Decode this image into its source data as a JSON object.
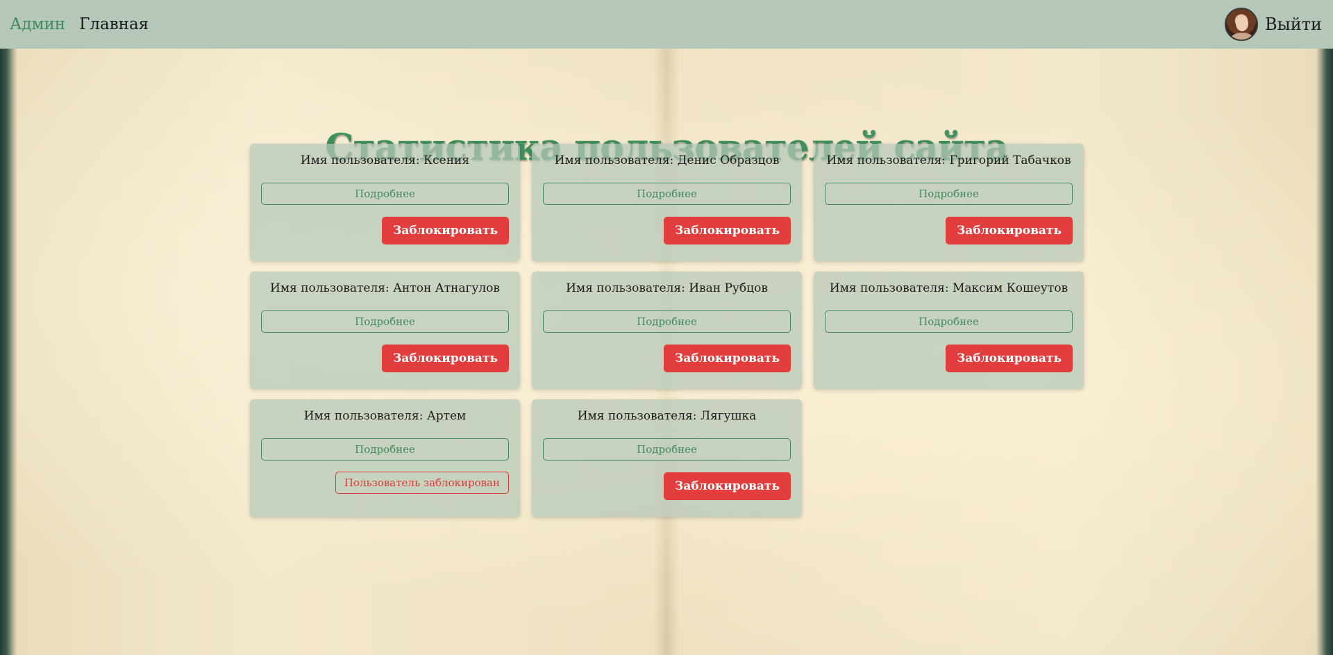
{
  "nav": {
    "admin_label": "Админ",
    "home_label": "Главная",
    "logout_label": "Выйти"
  },
  "page": {
    "title": "Статистика пользователей сайта"
  },
  "users": [
    {
      "title": "Имя пользователя: Ксения",
      "details_label": "Подробнее",
      "action_label": "Заблокировать",
      "blocked": false
    },
    {
      "title": "Имя пользователя: Денис Образцов",
      "details_label": "Подробнее",
      "action_label": "Заблокировать",
      "blocked": false
    },
    {
      "title": "Имя пользователя: Григорий Табачков",
      "details_label": "Подробнее",
      "action_label": "Заблокировать",
      "blocked": false
    },
    {
      "title": "Имя пользователя: Антон Атнагулов",
      "details_label": "Подробнее",
      "action_label": "Заблокировать",
      "blocked": false
    },
    {
      "title": "Имя пользователя: Иван Рубцов",
      "details_label": "Подробнее",
      "action_label": "Заблокировать",
      "blocked": false
    },
    {
      "title": "Имя пользователя: Максим Кошеутов",
      "details_label": "Подробнее",
      "action_label": "Заблокировать",
      "blocked": false
    },
    {
      "title": "Имя пользователя: Артем",
      "details_label": "Подробнее",
      "action_label": "Пользователь заблокирован",
      "blocked": true
    },
    {
      "title": "Имя пользователя: Лягушка",
      "details_label": "Подробнее",
      "action_label": "Заблокировать",
      "blocked": false
    }
  ],
  "colors": {
    "nav_bg": "#b4c7b9",
    "accent_green": "#3f8a5c",
    "title_green": "#3f915e",
    "danger_red": "#e23e3e"
  }
}
